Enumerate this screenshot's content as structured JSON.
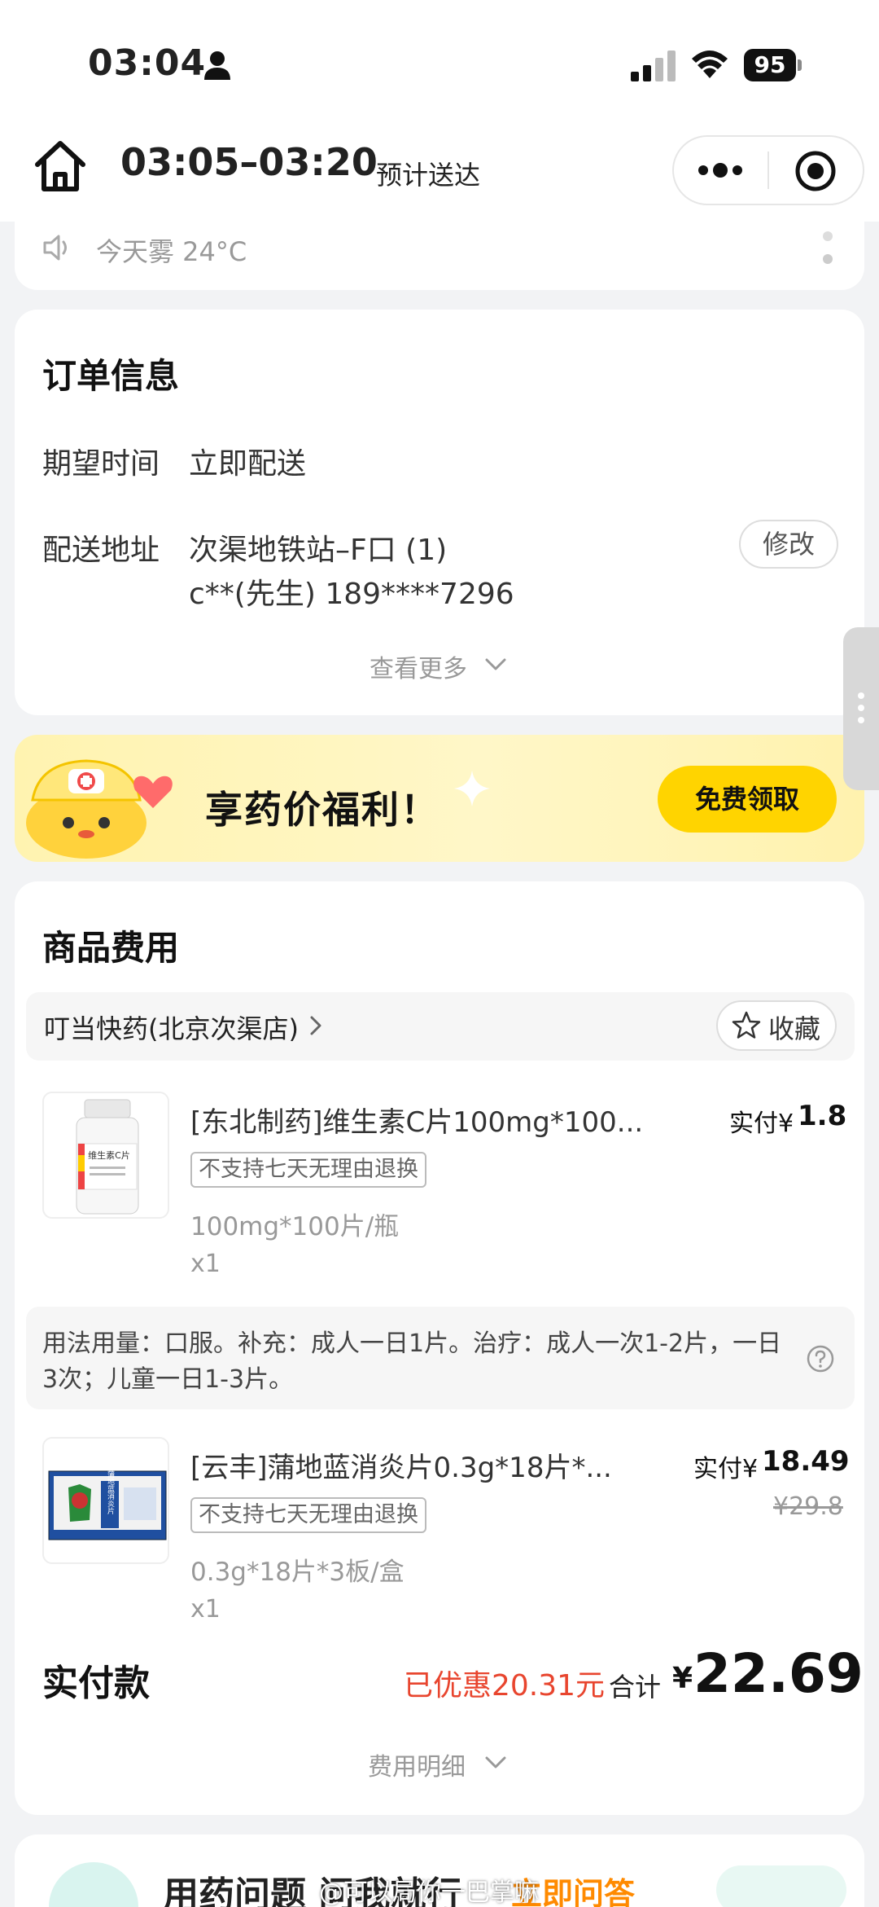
{
  "status_bar": {
    "time": "03:04",
    "battery": "95"
  },
  "header": {
    "eta_time": "03:05–03:20",
    "eta_label": "预计送达"
  },
  "weather": {
    "text": "今天雾 24°C"
  },
  "order_info": {
    "title": "订单信息",
    "expected_time_label": "期望时间",
    "expected_time_value": "立即配送",
    "address_label": "配送地址",
    "address_line1": "次渠地铁站–F口 (1)",
    "address_line2": "c**(先生) 189****7296",
    "edit_label": "修改",
    "more_label": "查看更多"
  },
  "promo": {
    "title": "享药价福利！",
    "button_label": "免费领取"
  },
  "goods": {
    "title": "商品费用",
    "store_name": "叮当快药(北京次渠店)",
    "favorite_label": "收藏",
    "items": [
      {
        "name": "[东北制药]维生素C片100mg*100...",
        "tag": "不支持七天无理由退换",
        "spec": "100mg*100片/瓶",
        "qty": "x1",
        "paid_label": "实付¥",
        "paid_amount": "1.8",
        "thumb_label": "维生素C片"
      },
      {
        "name": "[云丰]蒲地蓝消炎片0.3g*18片*...",
        "tag": "不支持七天无理由退换",
        "spec": "0.3g*18片*3板/盒",
        "qty": "x1",
        "paid_label": "实付¥",
        "paid_amount": "18.49",
        "original_price": "¥29.8",
        "thumb_label": "蒲地蓝消炎片"
      }
    ],
    "usage": "用法用量：口服。补充：成人一日1片。治疗：成人一次1-2片，一日3次；儿童一日1-3片。",
    "total_label": "实付款",
    "discount": "已优惠20.31元",
    "sum_label": "合计",
    "currency": "¥",
    "total_amount": "22.69",
    "detail_label": "费用明细"
  },
  "bottom": {
    "text": "用药问题 问我就行",
    "link": "立即问答"
  },
  "watermark": "@可以局你一巴掌嘛",
  "colors": {
    "accent_yellow": "#ffd400",
    "discount_red": "#e8452e",
    "background": "#f2f3f5"
  }
}
